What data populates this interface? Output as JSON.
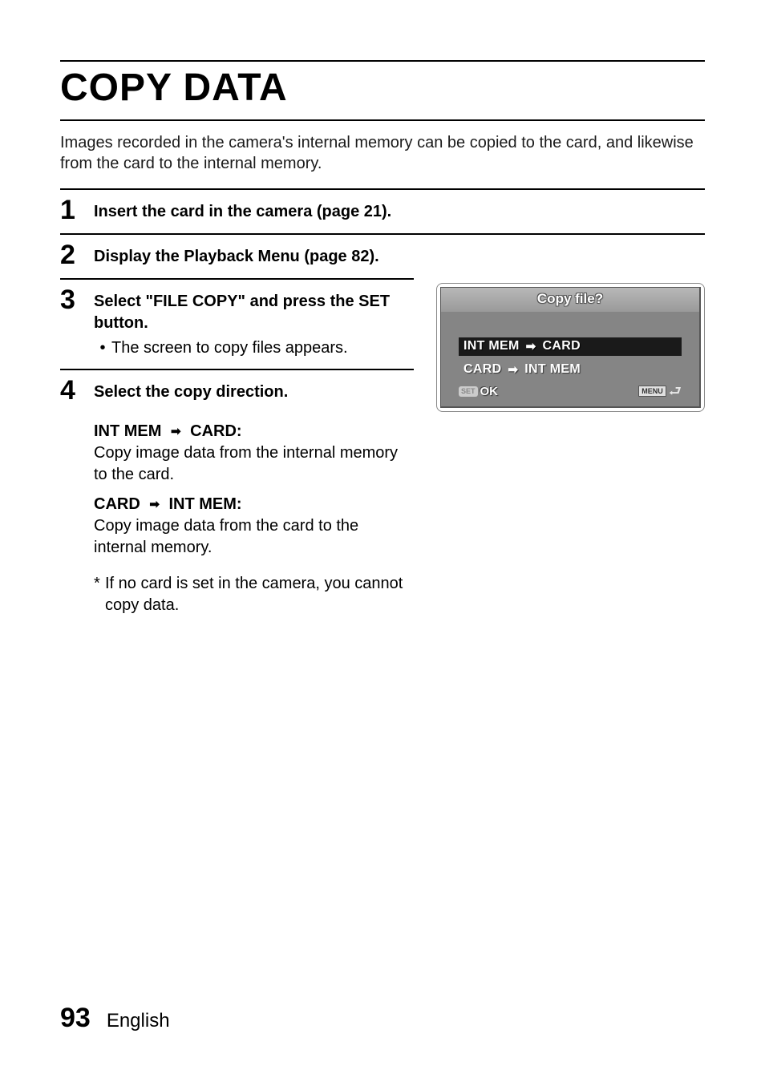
{
  "title": "COPY DATA",
  "intro": "Images recorded in the camera's internal memory can be copied to the card, and likewise from the card to the internal memory.",
  "steps": {
    "s1": {
      "num": "1",
      "text": "Insert the card in the camera (page 21)."
    },
    "s2": {
      "num": "2",
      "text": "Display the Playback Menu (page 82)."
    },
    "s3": {
      "num": "3",
      "heading_part1": "Select \"FILE COPY\" and press the SET button.",
      "bullet": "The screen to copy files appears."
    },
    "s4": {
      "num": "4",
      "heading": "Select the copy direction.",
      "opt1_label_left": "INT MEM",
      "opt1_label_right": "CARD:",
      "opt1_desc": "Copy image data from the internal memory to the card.",
      "opt2_label_left": "CARD",
      "opt2_label_right": "INT MEM:",
      "opt2_desc": "Copy image data from the card to the internal memory.",
      "note": "If no card is set in the camera, you cannot copy data."
    }
  },
  "dialog": {
    "title": "Copy file?",
    "opt1_left": "INT MEM",
    "opt1_right": "CARD",
    "opt2_left": "CARD",
    "opt2_right": "INT MEM",
    "set_label": "SET",
    "ok_label": "OK",
    "menu_label": "MENU"
  },
  "footer": {
    "page": "93",
    "lang": "English"
  }
}
